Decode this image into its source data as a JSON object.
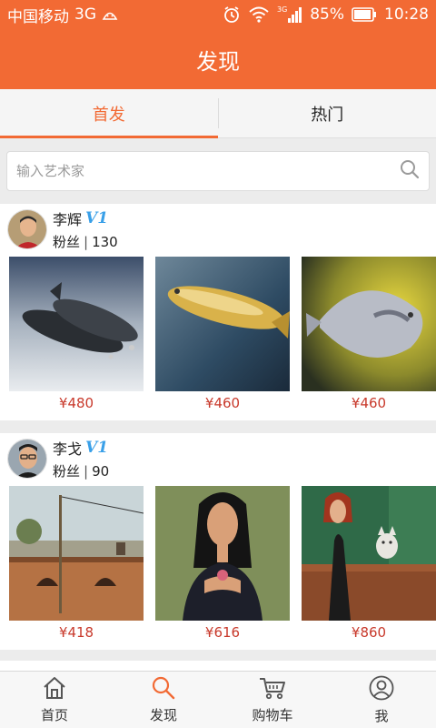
{
  "status": {
    "carrier": "中国移动",
    "network": "3G",
    "battery": "85%",
    "time": "10:28"
  },
  "title": "发现",
  "tabs": [
    {
      "label": "首发",
      "active": true
    },
    {
      "label": "热门",
      "active": false
    }
  ],
  "search": {
    "placeholder": "输入艺术家"
  },
  "artists": [
    {
      "name": "李辉",
      "badge": "V1",
      "fans_label": "粉丝",
      "fans_count": "130",
      "works": [
        {
          "price": "¥480",
          "subject": "two-fish-painting"
        },
        {
          "price": "¥460",
          "subject": "yellow-croaker-painting"
        },
        {
          "price": "¥460",
          "subject": "pomfret-painting"
        }
      ]
    },
    {
      "name": "李戈",
      "badge": "V1",
      "fans_label": "粉丝",
      "fans_count": "90",
      "works": [
        {
          "price": "¥418",
          "subject": "street-scene-painting"
        },
        {
          "price": "¥616",
          "subject": "woman-with-flower-painting"
        },
        {
          "price": "¥860",
          "subject": "woman-with-cat-painting"
        }
      ]
    }
  ],
  "bottom_nav": [
    {
      "label": "首页",
      "icon": "home-icon"
    },
    {
      "label": "发现",
      "icon": "search-icon"
    },
    {
      "label": "购物车",
      "icon": "cart-icon"
    },
    {
      "label": "我",
      "icon": "user-icon"
    }
  ],
  "colors": {
    "brand": "#f26a34",
    "price": "#c8392b",
    "badge": "#3aa0e8"
  }
}
